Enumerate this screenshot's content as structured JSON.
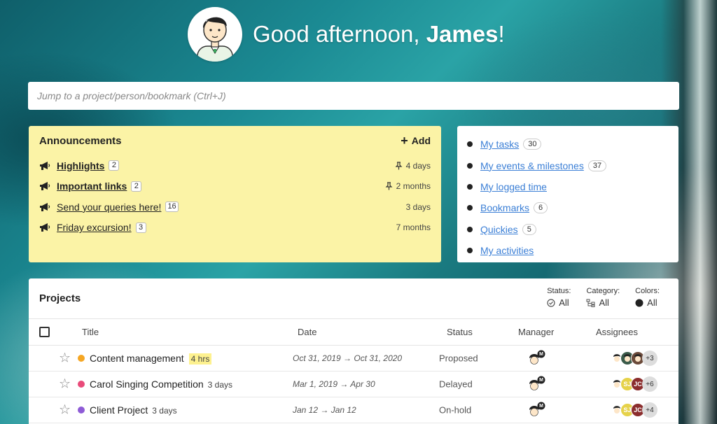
{
  "header": {
    "greeting_prefix": "Good afternoon, ",
    "user_name": "James",
    "greeting_suffix": "!"
  },
  "jump": {
    "placeholder": "Jump to a project/person/bookmark (Ctrl+J)"
  },
  "announcements": {
    "title": "Announcements",
    "add_label": "Add",
    "items": [
      {
        "label": "Highlights",
        "count": "2",
        "age": "4 days",
        "pinned": true,
        "bold": true
      },
      {
        "label": "Important links",
        "count": "2",
        "age": "2 months",
        "pinned": true,
        "bold": true
      },
      {
        "label": "Send your queries here!",
        "count": "16",
        "age": "3 days",
        "pinned": false,
        "bold": false
      },
      {
        "label": "Friday excursion!",
        "count": "3",
        "age": "7 months",
        "pinned": false,
        "bold": false
      }
    ]
  },
  "quick_links": [
    {
      "label": "My tasks",
      "count": "30"
    },
    {
      "label": "My events & milestones",
      "count": "37"
    },
    {
      "label": "My logged time",
      "count": ""
    },
    {
      "label": "Bookmarks",
      "count": "6"
    },
    {
      "label": "Quickies",
      "count": "5"
    },
    {
      "label": "My activities",
      "count": ""
    }
  ],
  "projects": {
    "title": "Projects",
    "filters": {
      "status_label": "Status:",
      "status_value": "All",
      "category_label": "Category:",
      "category_value": "All",
      "colors_label": "Colors:",
      "colors_value": "All"
    },
    "columns": [
      "Title",
      "Date",
      "Status",
      "Manager",
      "Assignees"
    ],
    "rows": [
      {
        "title": "Content management",
        "tag": "4 hrs",
        "tag_type": "hrs",
        "color": "#f5a623",
        "date_from": "Oct 31, 2019",
        "date_to": "Oct 31, 2020",
        "status": "Proposed",
        "assignee_initials": [
          "",
          "",
          ""
        ],
        "more": "+3"
      },
      {
        "title": "Carol Singing Competition",
        "tag": "3 days",
        "tag_type": "dur",
        "color": "#e94b7a",
        "date_from": "Mar 1, 2019",
        "date_to": "Apr 30",
        "status": "Delayed",
        "assignee_initials": [
          "",
          "SJ",
          "JC"
        ],
        "more": "+6"
      },
      {
        "title": "Client Project",
        "tag": "3 days",
        "tag_type": "dur",
        "color": "#8e5bd6",
        "date_from": "Jan 12",
        "date_to": "Jan 12",
        "status": "On-hold",
        "assignee_initials": [
          "",
          "SJ",
          "JC"
        ],
        "more": "+4"
      }
    ]
  },
  "colors": {
    "announce_bg": "#fbf3a6",
    "link": "#3b7fd6",
    "hrs_highlight": "#fdf18f"
  }
}
